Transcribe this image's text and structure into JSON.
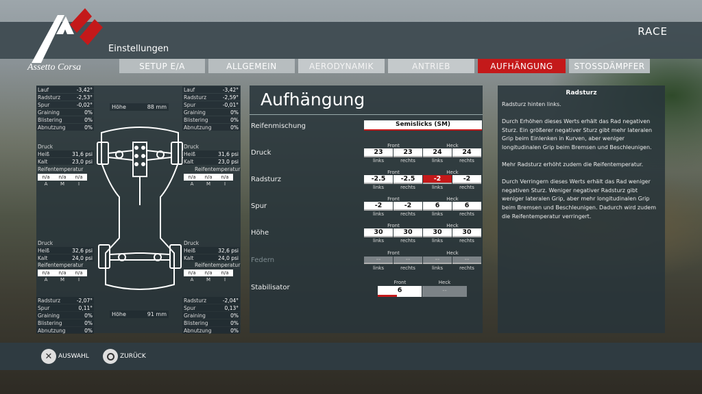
{
  "app": {
    "brand": "Assetto Corsa",
    "section": "Einstellungen",
    "mode": "RACE"
  },
  "tabs": [
    {
      "label": "SETUP E/A"
    },
    {
      "label": "ALLGEMEIN"
    },
    {
      "label": "AERODYNAMIK"
    },
    {
      "label": "ANTRIEB"
    },
    {
      "label": "AUFHÄNGUNG"
    },
    {
      "label": "STOSSDÄMPFER"
    }
  ],
  "car": {
    "fl": {
      "lauf": "-3,42°",
      "radsturz": "-2,53°",
      "spur": "-0,02°",
      "graining": "0%",
      "blistering": "0%",
      "abnutzung": "0%"
    },
    "fr": {
      "lauf": "-3,42°",
      "radsturz": "-2,59°",
      "spur": "-0,01°",
      "graining": "0%",
      "blistering": "0%",
      "abnutzung": "0%"
    },
    "rl": {
      "radsturz": "-2,07°",
      "spur": "0,11°",
      "graining": "0%",
      "blistering": "0%",
      "abnutzung": "0%"
    },
    "rr": {
      "radsturz": "-2,04°",
      "spur": "0,13°",
      "graining": "0%",
      "blistering": "0%",
      "abnutzung": "0%"
    },
    "labels": {
      "lauf": "Lauf",
      "radsturz": "Radsturz",
      "spur": "Spur",
      "graining": "Graining",
      "blistering": "Blistering",
      "abnutzung": "Abnutzung",
      "druck": "Druck",
      "heiss": "Heiß",
      "kalt": "Kalt",
      "reifentemp": "Reifentemperatur",
      "hoehe": "Höhe"
    },
    "front_pressure": {
      "left": {
        "heiss": "31,6 psi",
        "kalt": "23,0 psi"
      },
      "right": {
        "heiss": "31,6 psi",
        "kalt": "23,0 psi"
      }
    },
    "rear_pressure": {
      "left": {
        "heiss": "32,6 psi",
        "kalt": "24,0 psi"
      },
      "right": {
        "heiss": "32,6 psi",
        "kalt": "24,0 psi"
      }
    },
    "tyre_temp": {
      "values": [
        "n/a",
        "n/a",
        "n/a"
      ],
      "labels": [
        "A",
        "M",
        "I"
      ]
    },
    "front_height": "88 mm",
    "rear_height": "91 mm"
  },
  "main": {
    "title": "Aufhängung",
    "tyre_label": "Reifenmischung",
    "tyre_value": "Semislicks (SM)",
    "front": "Front",
    "rear": "Heck",
    "left": "links",
    "right": "rechts",
    "rows": [
      {
        "label": "Druck",
        "values": [
          "23",
          "23",
          "24",
          "24"
        ]
      },
      {
        "label": "Radsturz",
        "values": [
          "-2.5",
          "-2.5",
          "-2",
          "-2"
        ]
      },
      {
        "label": "Spur",
        "values": [
          "-2",
          "-2",
          "6",
          "6"
        ]
      },
      {
        "label": "Höhe",
        "values": [
          "30",
          "30",
          "30",
          "30"
        ]
      },
      {
        "label": "Federn",
        "values": [
          "--",
          "--",
          "--",
          "--"
        ]
      }
    ],
    "stab_label": "Stabilisator",
    "stab_front": "6",
    "stab_rear": "--"
  },
  "help": {
    "title": "Radsturz",
    "p1": "Radsturz hinten links.",
    "p2": "Durch Erhöhen dieses Werts erhält das Rad negativen Sturz. Ein größerer negativer Sturz gibt mehr lateralen Grip beim Einlenken in Kurven, aber weniger longitudinalen Grip beim Bremsen und Beschleunigen.",
    "p3": "Mehr Radsturz erhöht zudem die Reifentemperatur.",
    "p4": "Durch Verringern dieses Werts erhält das Rad weniger negativen Sturz. Weniger negativer Radsturz gibt weniger lateralen Grip, aber mehr longitudinalen Grip beim Bremsen und Beschleunigen. Dadurch wird zudem die Reifentemperatur verringert."
  },
  "controls": {
    "select": "AUSWAHL",
    "back": "ZURÜCK"
  },
  "colors": {
    "accent": "#c4191a",
    "panel": "#28343a"
  }
}
